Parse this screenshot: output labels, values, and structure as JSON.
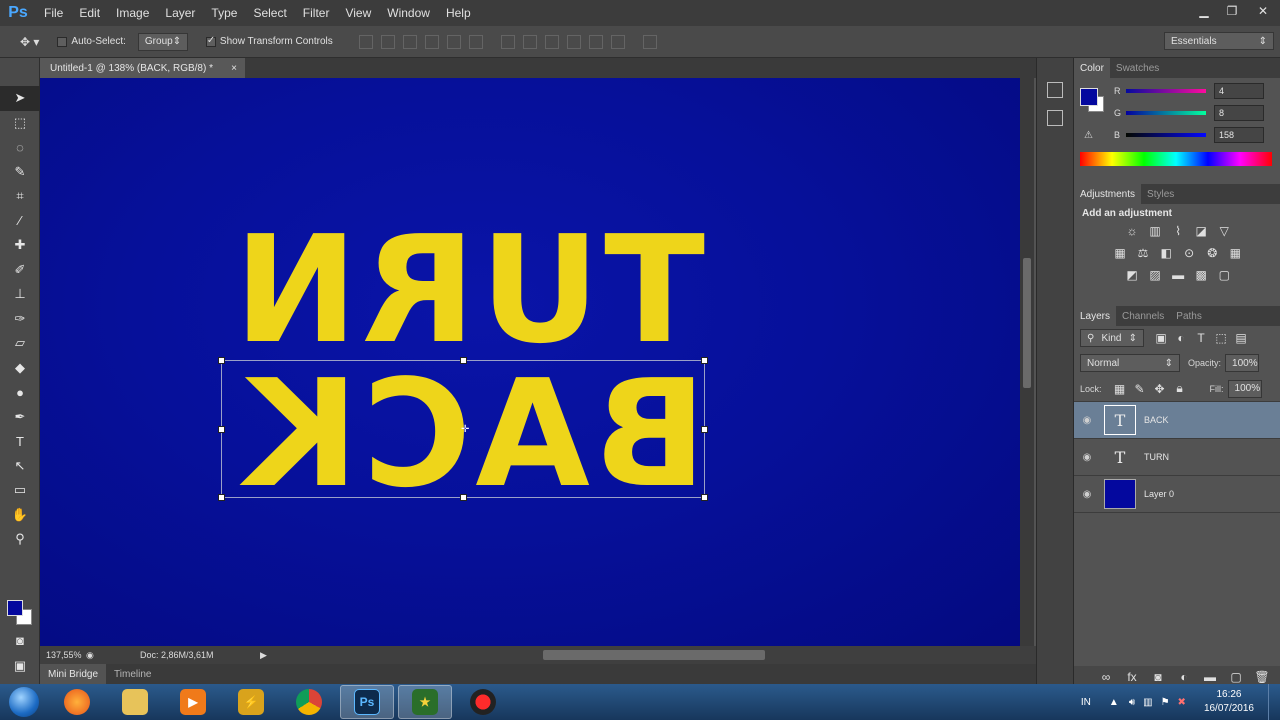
{
  "app": {
    "logo": "Ps"
  },
  "menu": [
    "File",
    "Edit",
    "Image",
    "Layer",
    "Type",
    "Select",
    "Filter",
    "View",
    "Window",
    "Help"
  ],
  "window_controls": {
    "minimize": "▁",
    "restore": "❐",
    "close": "✕"
  },
  "options": {
    "auto_select_label": "Auto-Select:",
    "auto_select_checked": false,
    "auto_select_value": "Group",
    "show_transform_label": "Show Transform Controls",
    "show_transform_checked": true,
    "workspace": "Essentials"
  },
  "document": {
    "tab_title": "Untitled-1 @ 138% (BACK, RGB/8) *",
    "close_glyph": "×",
    "canvas_texts": {
      "top_word": "TURN",
      "bottom_word": "BACK"
    },
    "zoom": "137,55%",
    "doc_size": "Doc: 2,86M/3,61M"
  },
  "bottom_tabs": [
    "Mini Bridge",
    "Timeline"
  ],
  "tools": [
    "move-tool",
    "marquee-tool",
    "lasso-tool",
    "quick-select-tool",
    "crop-tool",
    "eyedropper-tool",
    "healing-brush-tool",
    "brush-tool",
    "clone-stamp-tool",
    "history-brush-tool",
    "eraser-tool",
    "gradient-tool",
    "dodge-tool",
    "pen-tool",
    "type-tool",
    "path-select-tool",
    "rectangle-tool",
    "hand-tool",
    "zoom-tool"
  ],
  "colors": {
    "foreground": "#04089e",
    "background": "#ffffff",
    "canvas": "#06109a",
    "text_fill": "#eed51a"
  },
  "color_panel": {
    "tabs": [
      "Color",
      "Swatches"
    ],
    "channels": [
      {
        "label": "R",
        "value": "4"
      },
      {
        "label": "G",
        "value": "8"
      },
      {
        "label": "B",
        "value": "158"
      }
    ]
  },
  "adjustments_panel": {
    "tabs": [
      "Adjustments",
      "Styles"
    ],
    "heading": "Add an adjustment"
  },
  "layers_panel": {
    "tabs": [
      "Layers",
      "Channels",
      "Paths"
    ],
    "kind_label": "Kind",
    "blend_mode": "Normal",
    "opacity_label": "Opacity:",
    "opacity_value": "100%",
    "lock_label": "Lock:",
    "fill_label": "Fill:",
    "fill_value": "100%",
    "layers": [
      {
        "name": "BACK",
        "type": "text",
        "selected": true
      },
      {
        "name": "TURN",
        "type": "text",
        "selected": false
      },
      {
        "name": "Layer 0",
        "type": "fill",
        "selected": false
      }
    ]
  },
  "taskbar": {
    "apps": [
      "firefox",
      "file-explorer",
      "media-player",
      "winamp",
      "chrome",
      "photoshop",
      "movie-maker",
      "screen-recorder"
    ],
    "language": "IN",
    "time": "16:26",
    "date": "16/07/2016"
  }
}
